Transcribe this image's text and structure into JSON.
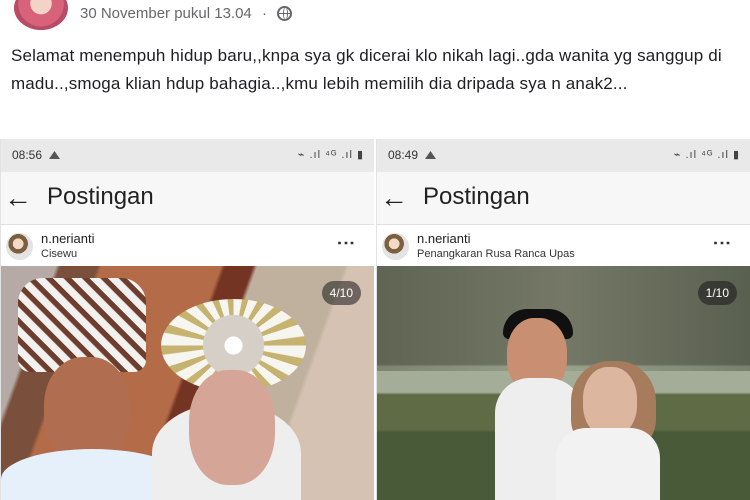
{
  "post": {
    "timestamp": "30 November pukul 13.04",
    "separator": "·",
    "caption": "Selamat menempuh hidup baru,,knpa sya gk dicerai klo nikah lagi..gda wanita yg sanggup di madu..,smoga klian hdup bahagia..,kmu lebih memilih dia dripada sya n anak2..."
  },
  "screenshots": [
    {
      "status_time": "08:56",
      "status_icons": "⌁ .ıl ⁴ᴳ .ıl ▮",
      "back_icon": "←",
      "title": "Postingan",
      "username": "n.nerianti",
      "location": "Cisewu",
      "menu_icon": "⋮",
      "page_count": "4/10"
    },
    {
      "status_time": "08:49",
      "status_icons": "⌁ .ıl ⁴ᴳ .ıl ▮",
      "back_icon": "←",
      "title": "Postingan",
      "username": "n.nerianti",
      "location": "Penangkaran Rusa Ranca Upas",
      "menu_icon": "⋮",
      "page_count": "1/10"
    }
  ]
}
